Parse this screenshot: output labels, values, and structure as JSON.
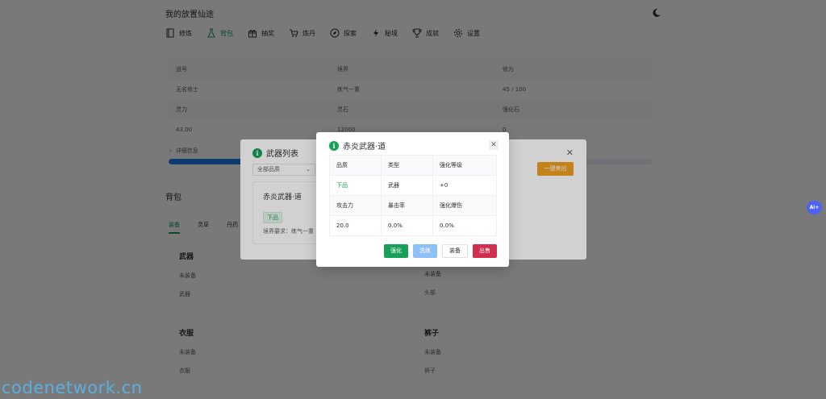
{
  "app": {
    "title": "我的放置仙途"
  },
  "nav": [
    {
      "label": "修炼",
      "icon": "book-icon"
    },
    {
      "label": "背包",
      "icon": "flask-icon",
      "active": true
    },
    {
      "label": "抽奖",
      "icon": "gift-icon"
    },
    {
      "label": "炼丹",
      "icon": "cart-icon"
    },
    {
      "label": "探索",
      "icon": "compass-icon"
    },
    {
      "label": "秘境",
      "icon": "lightning-icon"
    },
    {
      "label": "成就",
      "icon": "trophy-icon"
    },
    {
      "label": "设置",
      "icon": "gear-icon"
    }
  ],
  "stats": {
    "rows": [
      [
        "道号",
        "境界",
        "修为"
      ],
      [
        "无名修士",
        "练气一重",
        "45 / 100"
      ],
      [
        "灵力",
        "灵石",
        "强化石"
      ],
      [
        "43.00",
        "12000",
        "0"
      ]
    ],
    "detail_label": "详细信息",
    "progress": 0.45
  },
  "bag": {
    "title": "背包",
    "tabs": [
      "装备",
      "灵草",
      "丹药"
    ],
    "slots": [
      {
        "title": "武器",
        "status": "未装备",
        "name": "武器"
      },
      {
        "title": "",
        "status": "未装备",
        "name": "头部"
      },
      {
        "title": "衣服",
        "status": "未装备",
        "name": "衣服"
      },
      {
        "title": "裤子",
        "status": "未装备",
        "name": "裤子"
      }
    ]
  },
  "weapon_list": {
    "title": "武器列表",
    "filter": "全部品质",
    "sell_all": "一键卖出",
    "card": {
      "name": "赤炎武器·道",
      "tag": "下品",
      "requirement": "境界要求：练气一重"
    }
  },
  "dialog": {
    "title": "赤炎武器·道",
    "table": [
      [
        "品质",
        "类型",
        "强化等级"
      ],
      [
        "下品",
        "武器",
        "+0"
      ],
      [
        "攻击力",
        "暴击率",
        "强化爆伤"
      ],
      [
        "20.0",
        "0.0%",
        "0.0%"
      ]
    ],
    "buttons": {
      "enhance": "强化",
      "refine": "洗练",
      "equip": "装备",
      "sell": "出售"
    }
  },
  "ai_badge": "Ai+",
  "watermark": "codenetwork.cn",
  "colors": {
    "primary": "#18a058",
    "warning": "#f0a020",
    "error": "#d03050",
    "info": "#2080f0"
  }
}
